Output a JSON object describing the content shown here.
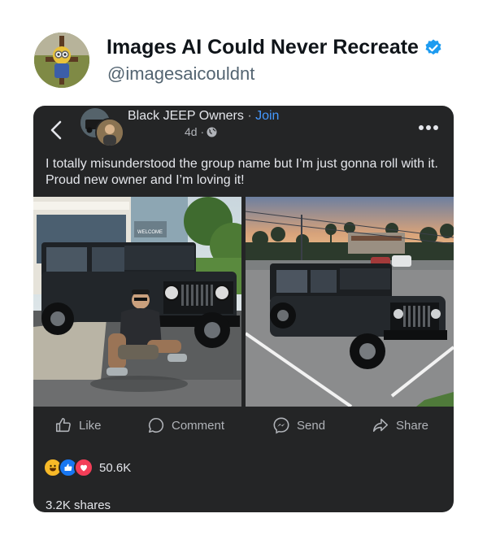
{
  "tweet": {
    "display_name": "Images AI Could Never Recreate",
    "handle": "@imagesaicouldnt"
  },
  "post": {
    "group_name": "Black JEEP Owners",
    "separator": " · ",
    "join_label": "Join",
    "time": "4d ·",
    "text": "I totally misunderstood the group name but I’m just gonna roll with it. Proud new owner and I’m loving it!",
    "photo_sign": "WELCOME"
  },
  "actions": {
    "like": "Like",
    "comment": "Comment",
    "send": "Send",
    "share": "Share"
  },
  "stats": {
    "reaction_count": "50.6K",
    "shares": "3.2K shares"
  },
  "colors": {
    "card_bg": "#242526",
    "link_blue": "#4599ff",
    "verified_blue": "#1d9bf0"
  }
}
